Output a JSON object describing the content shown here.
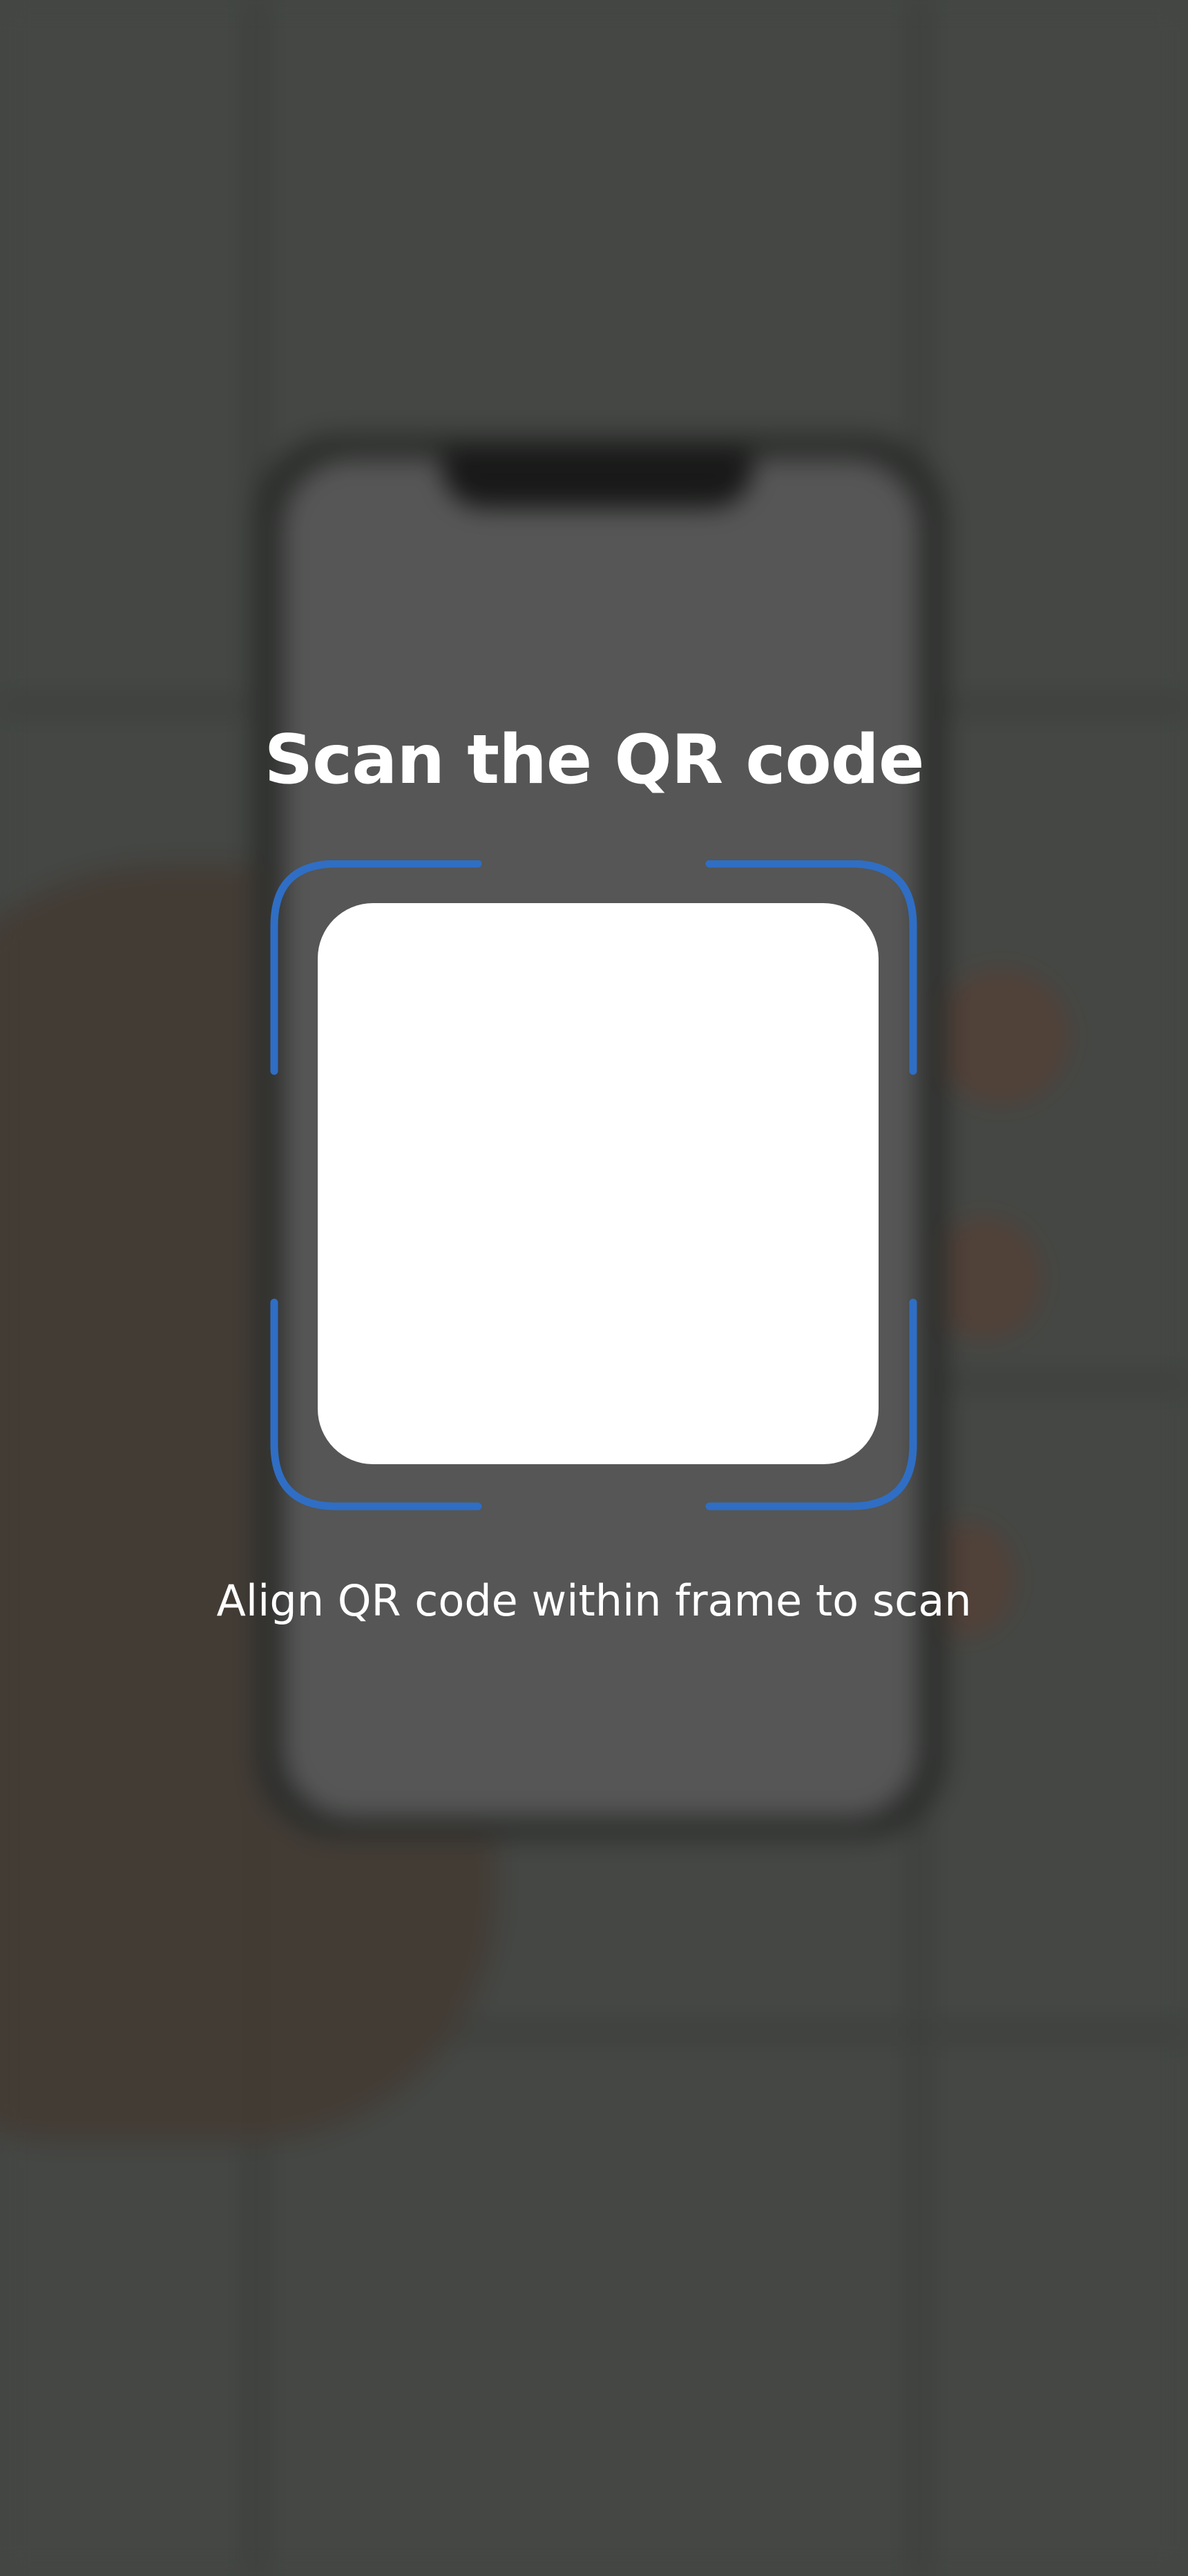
{
  "screen": {
    "title": "Scan the QR code",
    "instruction": "Align QR code within frame to scan"
  },
  "scanner": {
    "frame_icon": "scan-frame-icon",
    "accent_color": "#2f6ec4"
  },
  "background": {
    "description_icon": "camera-preview"
  }
}
